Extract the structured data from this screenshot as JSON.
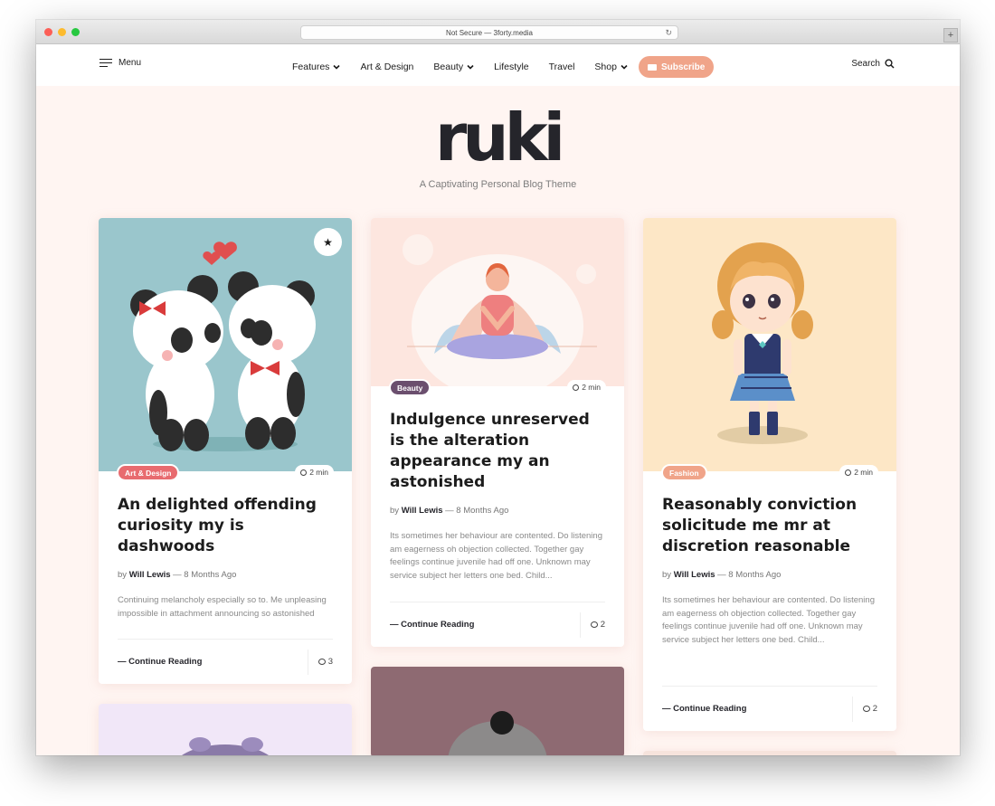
{
  "browser": {
    "url": "Not Secure — 3forty.media",
    "reload_icon": "reload-icon",
    "new_tab_icon": "plus-icon"
  },
  "nav": {
    "menu_label": "Menu",
    "links": [
      "Features",
      "Art & Design",
      "Beauty",
      "Lifestyle",
      "Travel",
      "Shop"
    ],
    "subscribe_label": "Subscribe",
    "search_label": "Search"
  },
  "brand": {
    "logo": "ruki",
    "tagline": "A Captivating Personal Blog Theme"
  },
  "colors": {
    "accent": "#f0a489",
    "page_bg": "#fff5f2",
    "art_badge": "#e86b6f",
    "beauty_badge": "#6b4f6e",
    "fashion_badge": "#f0a489"
  },
  "posts": [
    {
      "category": "Art & Design",
      "read_time": "2 min",
      "title": "An delighted offending curiosity my is dashwoods",
      "by": "by",
      "author": "Will Lewis",
      "date": "— 8 Months Ago",
      "excerpt": "Continuing melancholy especially so to. Me unpleasing impossible in attachment announcing so astonished",
      "continue": "— Continue Reading",
      "comments": "3",
      "image": "pandas-illustration"
    },
    {
      "category": "Beauty",
      "read_time": "2 min",
      "title": "Indulgence unreserved is the alteration appearance my an astonished",
      "by": "by",
      "author": "Will Lewis",
      "date": "— 8 Months Ago",
      "excerpt": "Its sometimes her behaviour are contented. Do listening am eagerness oh objection collected. Together gay feelings continue juvenile had off one. Unknown may service subject her letters one bed. Child...",
      "continue": "— Continue Reading",
      "comments": "2",
      "image": "meditation-illustration"
    },
    {
      "category": "Fashion",
      "read_time": "2 min",
      "title": "Reasonably conviction solicitude me mr at discretion reasonable",
      "by": "by",
      "author": "Will Lewis",
      "date": "— 8 Months Ago",
      "excerpt": "Its sometimes her behaviour are contented. Do listening am eagerness oh objection collected. Together gay feelings continue juvenile had off one. Unknown may service subject her letters one bed. Child...",
      "continue": "— Continue Reading",
      "comments": "2",
      "image": "schoolgirl-illustration"
    }
  ]
}
